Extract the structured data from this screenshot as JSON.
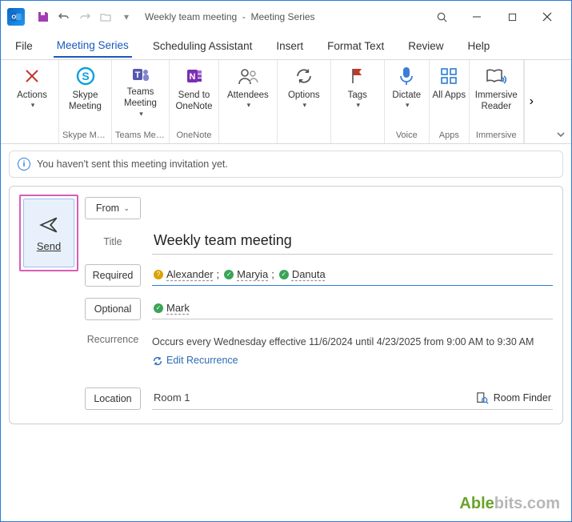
{
  "title": {
    "doc": "Weekly team meeting",
    "context": "Meeting Series"
  },
  "menutabs": {
    "file": "File",
    "meeting_series": "Meeting Series",
    "scheduling": "Scheduling Assistant",
    "insert": "Insert",
    "format_text": "Format Text",
    "review": "Review",
    "help": "Help"
  },
  "ribbon": {
    "actions": "Actions",
    "skype": "Skype Meeting",
    "teams": "Teams Meeting",
    "onenote": "Send to OneNote",
    "attendees": "Attendees",
    "options": "Options",
    "tags": "Tags",
    "dictate": "Dictate",
    "allapps": "All Apps",
    "immersive": "Immersive Reader",
    "group_skype": "Skype Me...",
    "group_teams": "Teams Meet...",
    "group_onenote": "OneNote",
    "group_voice": "Voice",
    "group_apps": "Apps",
    "group_immersive": "Immersive"
  },
  "notice": "You haven't sent this meeting invitation yet.",
  "form": {
    "send": "Send",
    "from": "From",
    "title_label": "Title",
    "title_value": "Weekly team meeting",
    "required_label": "Required",
    "optional_label": "Optional",
    "recurrence_label": "Recurrence",
    "recurrence_text": "Occurs every Wednesday effective 11/6/2024 until 4/23/2025 from 9:00 AM to 9:30 AM",
    "edit_recurrence": "Edit Recurrence",
    "location_label": "Location",
    "location_value": "Room 1",
    "room_finder": "Room Finder",
    "required_attendees": [
      {
        "name": "Alexander",
        "status": "tentative"
      },
      {
        "name": "Maryia",
        "status": "accepted"
      },
      {
        "name": "Danuta",
        "status": "accepted"
      }
    ],
    "optional_attendees": [
      {
        "name": "Mark",
        "status": "accepted"
      }
    ]
  },
  "brand": {
    "a": "Able",
    "b": "bits.com"
  }
}
